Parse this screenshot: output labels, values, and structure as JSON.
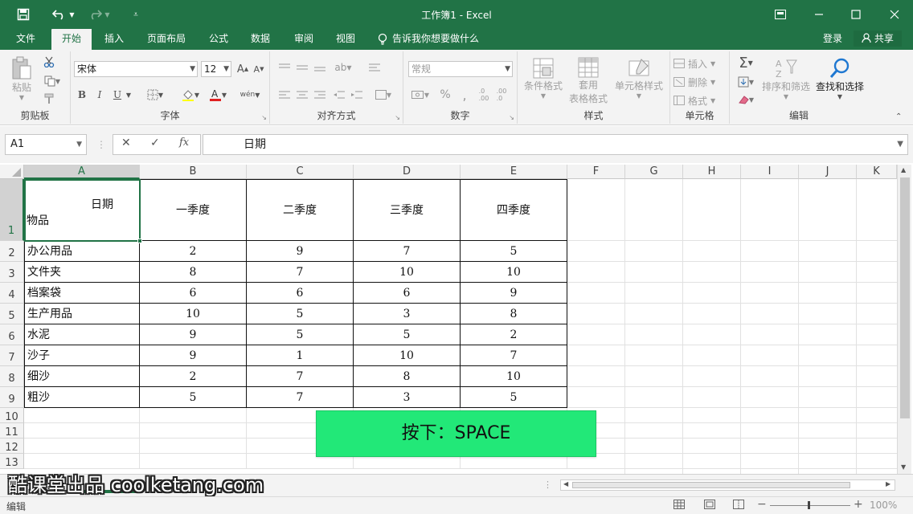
{
  "titlebar": {
    "title": "工作簿1 - Excel",
    "icons": [
      "save-icon",
      "undo-icon",
      "redo-icon",
      "customize-quick-access-icon",
      "ribbon-display-options-icon",
      "minimize-icon",
      "maximize-icon",
      "close-icon"
    ]
  },
  "tabs": {
    "items": [
      "文件",
      "开始",
      "插入",
      "页面布局",
      "公式",
      "数据",
      "审阅",
      "视图"
    ],
    "active": "开始",
    "tell_me": "告诉我你想要做什么",
    "login": "登录",
    "share": "共享"
  },
  "ribbon": {
    "clipboard": {
      "label": "剪贴板",
      "paste": "粘贴"
    },
    "font": {
      "label": "字体",
      "font_name": "宋体",
      "font_size": "12",
      "bold": "B",
      "italic": "I",
      "underline": "U"
    },
    "alignment": {
      "label": "对齐方式"
    },
    "number": {
      "label": "数字",
      "format": "常规"
    },
    "styles": {
      "label": "样式",
      "conditional": "条件格式",
      "table_format_1": "套用",
      "table_format_2": "表格格式",
      "cell_styles": "单元格样式"
    },
    "cells": {
      "label": "单元格",
      "insert": "插入",
      "delete": "删除",
      "format": "格式"
    },
    "editing": {
      "label": "编辑",
      "sort_filter": "排序和筛选",
      "find_select": "查找和选择"
    }
  },
  "formula_bar": {
    "name_box": "A1",
    "cancel": "✕",
    "enter": "✓",
    "fx": "fx",
    "content": "日期"
  },
  "sheet": {
    "columns": [
      "A",
      "B",
      "C",
      "D",
      "E",
      "F",
      "G",
      "H",
      "I",
      "J",
      "K"
    ],
    "rows": [
      "1",
      "2",
      "3",
      "4",
      "5",
      "6",
      "7",
      "8",
      "9",
      "10",
      "11",
      "12",
      "13"
    ],
    "header": {
      "a1_top": "日期",
      "a1_bottom": "物品",
      "quarters": [
        "一季度",
        "二季度",
        "三季度",
        "四季度"
      ]
    },
    "data": [
      {
        "item": "办公用品",
        "q": [
          "2",
          "9",
          "7",
          "5"
        ]
      },
      {
        "item": "文件夹",
        "q": [
          "8",
          "7",
          "10",
          "10"
        ]
      },
      {
        "item": "档案袋",
        "q": [
          "6",
          "6",
          "6",
          "9"
        ]
      },
      {
        "item": "生产用品",
        "q": [
          "10",
          "5",
          "3",
          "8"
        ]
      },
      {
        "item": "水泥",
        "q": [
          "9",
          "5",
          "5",
          "2"
        ]
      },
      {
        "item": "沙子",
        "q": [
          "9",
          "1",
          "10",
          "7"
        ]
      },
      {
        "item": "细沙",
        "q": [
          "2",
          "7",
          "8",
          "10"
        ]
      },
      {
        "item": "粗沙",
        "q": [
          "5",
          "7",
          "3",
          "5"
        ]
      }
    ]
  },
  "overlay": {
    "keystroke": "按下：SPACE",
    "watermark": "酷课堂出品 coolketang.com",
    "accent": "#22e878"
  },
  "status": {
    "mode": "编辑",
    "zoom": "100%"
  },
  "colors": {
    "excel_green": "#217346"
  }
}
